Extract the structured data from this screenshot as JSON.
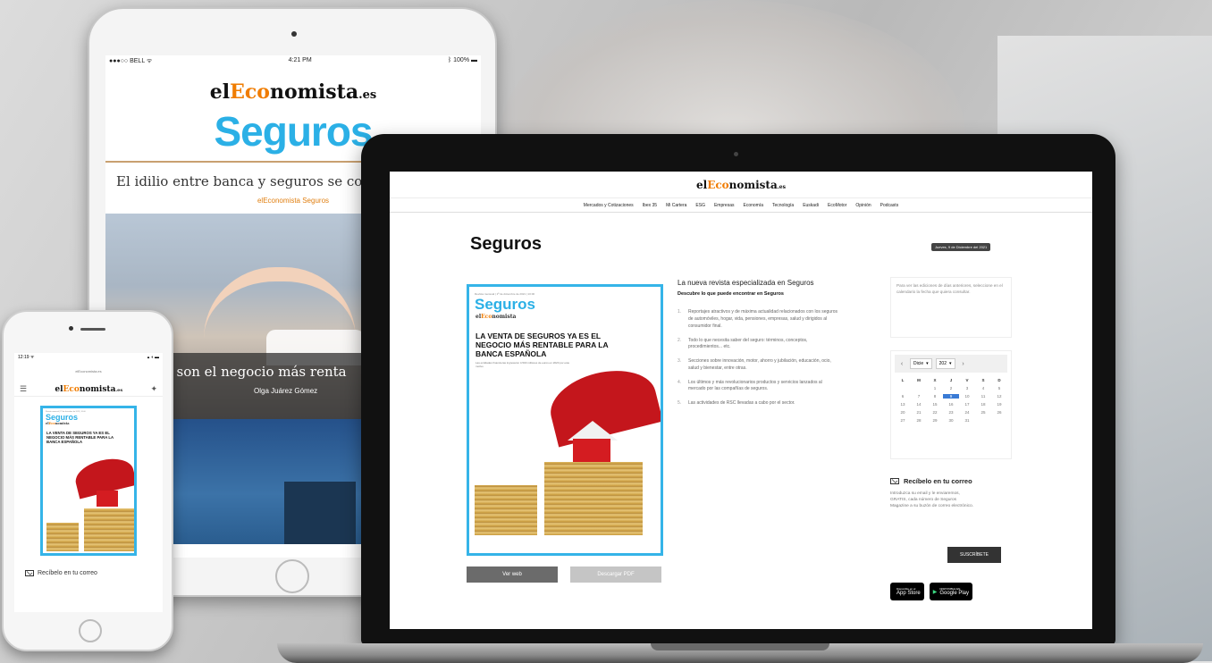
{
  "brand": {
    "logo_pre": "el",
    "logo_ec": "Eco",
    "logo_post": "nomista",
    "logo_suffix_tablet": ".es",
    "logo_suffix_small": ".es"
  },
  "tablet": {
    "status_left": "●●●○○ BELL ᯤ",
    "status_time": "4:21 PM",
    "status_right": "ᛒ 100% ▬",
    "section_title": "Seguros",
    "headline": "El idilio entre banca y seguros se co",
    "author_line": "elEconomista Seguros",
    "caption": "os son el negocio más renta",
    "caption_author": "Olga Juárez Gómez"
  },
  "phone": {
    "status_time": "12:19 ᯤ",
    "status_right": "▴ ◖ ▬",
    "url": "elEconomista.es",
    "menu_icon": "☰",
    "mail_label": "Recíbelo en tu correo"
  },
  "cover": {
    "top": "Revista mensual | 1ª de diciembre de 2021 | 10:00",
    "title": "Seguros",
    "logo_pre": "el",
    "logo_ec": "Eco",
    "logo_post": "nomista",
    "headline": "LA VENTA DE SEGUROS YA ES EL NEGOCIO MÁS RENTABLE PARA LA BANCA ESPAÑOLA",
    "sub": "Las entidades financieras ingresaron 4.500 millones de euros en 2020 por este motivo"
  },
  "laptop": {
    "logo_pre": "el",
    "logo_ec": "Eco",
    "logo_post": "nomista",
    "logo_suffix": ".es",
    "nav": [
      "Mercados y Cotizaciones",
      "Ibex 35",
      "Mi Cartera",
      "ESG",
      "Empresas",
      "Economía",
      "Tecnología",
      "Euskadi",
      "EcoMotor",
      "Opinión",
      "Podcasts"
    ],
    "page_title": "Seguros",
    "date": "Jueves, 9 de Diciembre del 2021",
    "intro_title": "La nueva revista especializada en Seguros",
    "intro_sub": "Descubre lo que puede encontrar en Seguros",
    "list": [
      {
        "n": "1.",
        "text": "Reportajes atractivos y de máxima actualidad relacionados con los seguros de automóviles, hogar, vida, pensiones, empresas, salud y dirigidos al consumidor final."
      },
      {
        "n": "2.",
        "text": "Todo lo que necesita saber del seguro: términos, conceptos, procedimientos... etc."
      },
      {
        "n": "3.",
        "text": "Secciones sobre innovación, motor, ahorro y jubilación, educación, ocio, salud y bienestar, entre otras."
      },
      {
        "n": "4.",
        "text": "Los últimos y más revolucionarios productos y servicios lanzados al mercado por las compañías de seguros."
      },
      {
        "n": "5.",
        "text": "Las actividades de RSC llevadas a cabo por el sector."
      }
    ],
    "btn_web": "Ver web",
    "btn_pdf": "Descargar PDF",
    "side_text": "Para ver las ediciones de días anteriores, seleccione en el calendario la fecha que quiera consultar.",
    "cal_prev": "‹",
    "cal_next": "›",
    "cal_month": "Dicie",
    "cal_year": "202",
    "cal_heads": [
      "L",
      "M",
      "X",
      "J",
      "V",
      "S",
      "D"
    ],
    "cal_days": [
      "",
      "",
      "1",
      "2",
      "3",
      "4",
      "5",
      "6",
      "7",
      "8",
      "9",
      "10",
      "11",
      "12",
      "13",
      "14",
      "15",
      "16",
      "17",
      "18",
      "19",
      "20",
      "21",
      "22",
      "23",
      "24",
      "25",
      "26",
      "27",
      "28",
      "29",
      "30",
      "31",
      "",
      ""
    ],
    "cal_today": "9",
    "mail_title": "Recíbelo en tu correo",
    "mail_text": "Introduzca su email y le enviaremos, GRATIS, cada número de Seguros Magazine a su buzón de correo electrónico.",
    "btn_subscribe": "SUSCRÍBETE",
    "appstore_small": "Disponible en el",
    "appstore": "App Store",
    "googleplay_small": "DISPONIBLE EN",
    "googleplay": "Google Play"
  },
  "colors": {
    "accent": "#2bb0e6",
    "brand_orange": "#f07c00",
    "umbrella": "#c4161c",
    "today": "#3a7bd5"
  }
}
